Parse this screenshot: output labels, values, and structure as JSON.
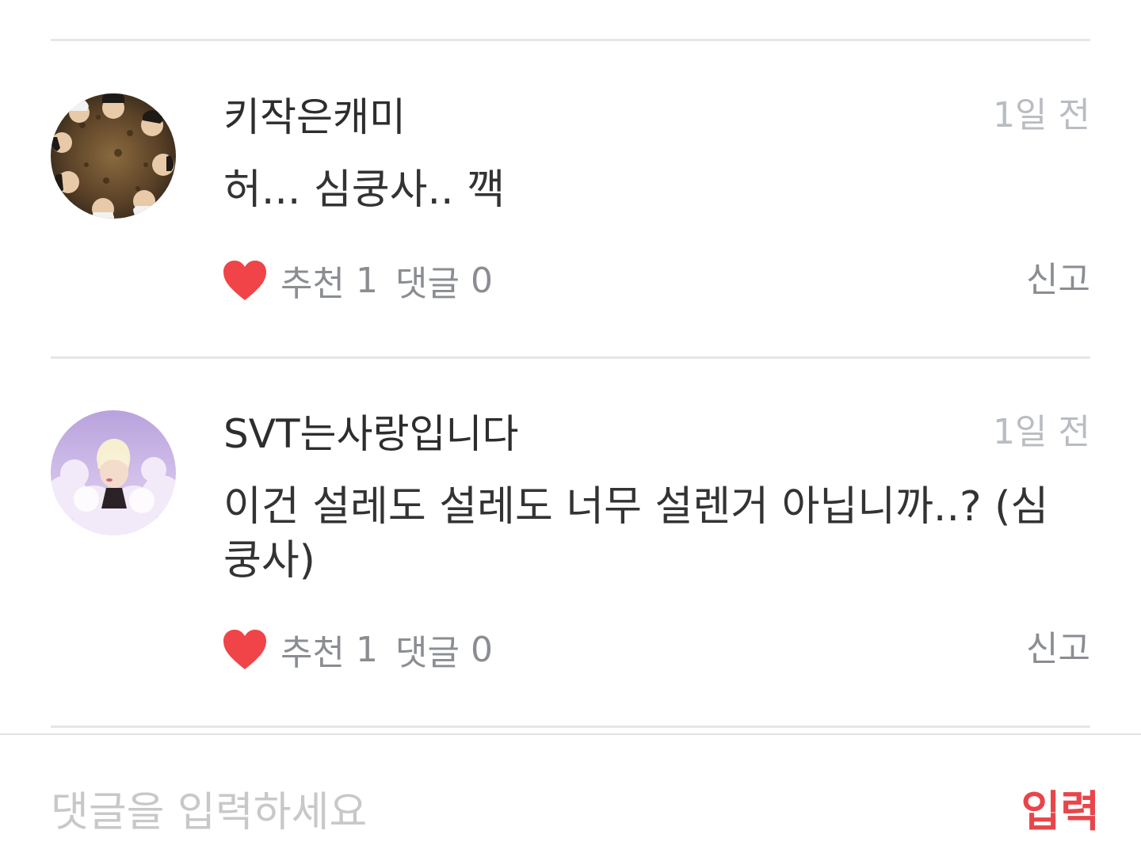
{
  "comments": [
    {
      "username": "키작은캐미",
      "time": "1일 전",
      "text": "허... 심쿵사.. 깩",
      "like_label": "추천",
      "like_count": "1",
      "reply_label": "댓글",
      "reply_count": "0",
      "report_label": "신고"
    },
    {
      "username": "SVT는사랑입니다",
      "time": "1일 전",
      "text": "이건 설레도 설레도 너무 설렌거 아닙니까..? (심쿵사)",
      "like_label": "추천",
      "like_count": "1",
      "reply_label": "댓글",
      "reply_count": "0",
      "report_label": "신고"
    }
  ],
  "input": {
    "placeholder": "댓글을 입력하세요",
    "value": "",
    "submit_label": "입력"
  },
  "colors": {
    "heart": "#f04448",
    "submit": "#e8454a",
    "muted_text": "#8a8d92",
    "time_text": "#b9bcc0",
    "divider": "#e6e6e6"
  },
  "icons": {
    "like": "heart-icon"
  }
}
